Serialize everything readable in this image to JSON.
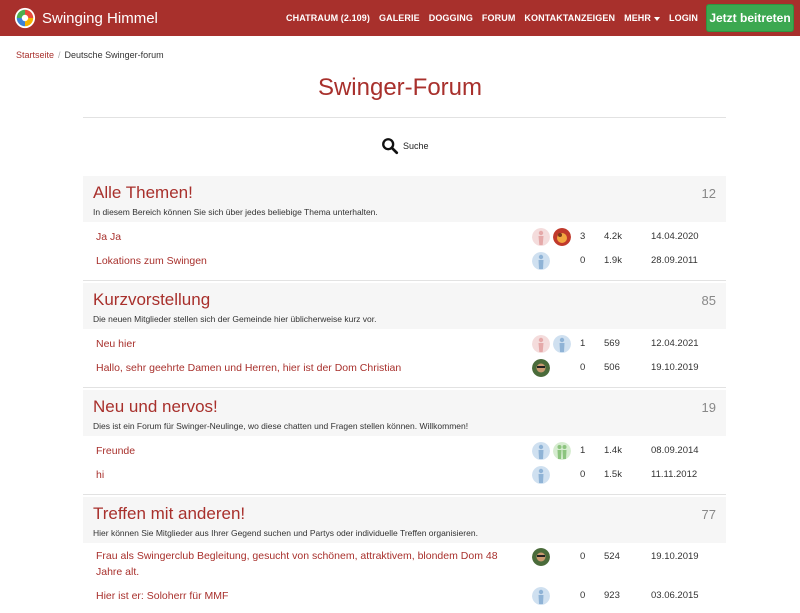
{
  "navbar": {
    "brand": "Swinging Himmel",
    "links": [
      "CHATRAUM (2.109)",
      "GALERIE",
      "DOGGING",
      "FORUM",
      "KONTAKTANZEIGEN",
      "MEHR",
      "LOGIN"
    ],
    "join_button": "Jetzt beitreten",
    "color": "#a8302c",
    "join_color": "#3ca850"
  },
  "breadcrumb": {
    "home": "Startseite",
    "current": "Deutsche Swinger-forum"
  },
  "page_title": "Swinger-Forum",
  "search": {
    "label": "Suche"
  },
  "sections": [
    {
      "title": "Alle Themen!",
      "description": "In diesem Bereich können Sie sich über jedes beliebige Thema unterhalten.",
      "count": "12",
      "threads": [
        {
          "title": "Ja Ja",
          "avatars": [
            "avatar-default-female",
            "avatar-photo"
          ],
          "replies": "3",
          "views": "4.2k",
          "date": "14.04.2020"
        },
        {
          "title": "Lokations zum Swingen",
          "avatars": [
            "avatar-default-male"
          ],
          "replies": "0",
          "views": "1.9k",
          "date": "28.09.2011"
        }
      ]
    },
    {
      "title": "Kurzvorstellung",
      "description": "Die neuen Mitglieder stellen sich der Gemeinde hier üblicherweise kurz vor.",
      "count": "85",
      "threads": [
        {
          "title": "Neu hier",
          "avatars": [
            "avatar-default-female",
            "avatar-default-male"
          ],
          "replies": "1",
          "views": "569",
          "date": "12.04.2021"
        },
        {
          "title": "Hallo, sehr geehrte Damen und Herren, hier ist der Dom Christian",
          "avatars": [
            "avatar-photo-sunglasses"
          ],
          "replies": "0",
          "views": "506",
          "date": "19.10.2019"
        }
      ]
    },
    {
      "title": "Neu und nervos!",
      "description": "Dies ist ein Forum für Swinger-Neulinge, wo diese chatten und Fragen stellen können. Willkommen!",
      "count": "19",
      "threads": [
        {
          "title": "Freunde",
          "avatars": [
            "avatar-default-male",
            "avatar-default-couple"
          ],
          "replies": "1",
          "views": "1.4k",
          "date": "08.09.2014"
        },
        {
          "title": "hi",
          "avatars": [
            "avatar-default-male"
          ],
          "replies": "0",
          "views": "1.5k",
          "date": "11.11.2012"
        }
      ]
    },
    {
      "title": "Treffen mit anderen!",
      "description": "Hier können Sie Mitglieder aus Ihrer Gegend suchen und Partys oder individuelle Treffen organisieren.",
      "count": "77",
      "threads": [
        {
          "title": "Frau als Swingerclub Begleitung, gesucht von schönem, attraktivem, blondem Dom 48 Jahre alt.",
          "avatars": [
            "avatar-photo-sunglasses"
          ],
          "replies": "0",
          "views": "524",
          "date": "19.10.2019"
        },
        {
          "title": "Hier ist er: Soloherr für MMF",
          "avatars": [
            "avatar-default-male"
          ],
          "replies": "0",
          "views": "923",
          "date": "03.06.2015"
        }
      ]
    }
  ]
}
